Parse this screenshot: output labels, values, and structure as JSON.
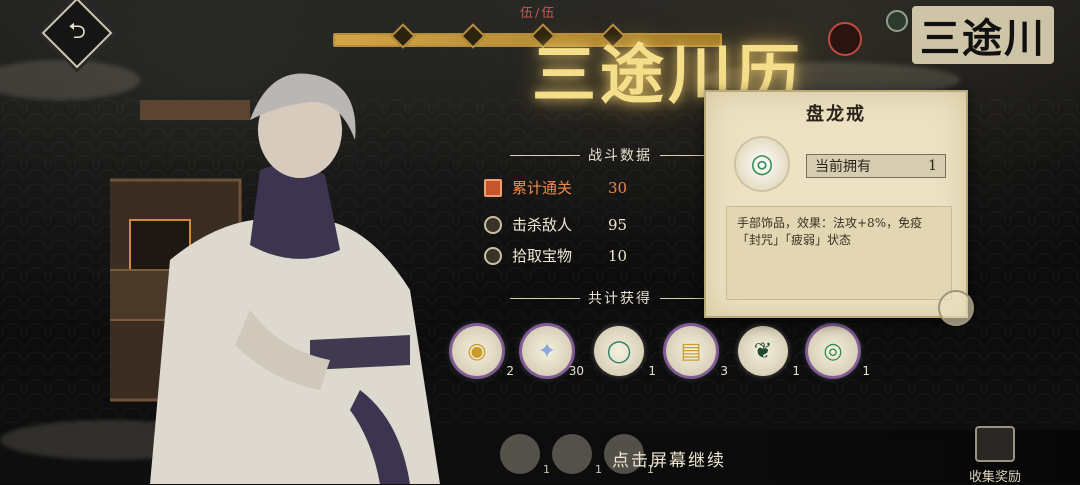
{
  "header": {
    "stage_count": "伍/伍",
    "title": "三途川历",
    "logo": "三途川",
    "progress": 1.0
  },
  "stats": {
    "section_title": "战斗数据",
    "rows": [
      {
        "label": "累计通关",
        "value": "30",
        "icon": "scroll-icon",
        "active": true
      },
      {
        "label": "击杀敌人",
        "value": "95",
        "icon": "coin-icon",
        "active": false
      },
      {
        "label": "拾取宝物",
        "value": "10",
        "icon": "coin-icon",
        "active": false
      }
    ]
  },
  "rewards": {
    "section_title": "共计获得",
    "items": [
      {
        "icon": "gold-coin-icon",
        "count": "2"
      },
      {
        "icon": "crystal-star-icon",
        "count": "30"
      },
      {
        "icon": "bracelet-icon",
        "count": "1"
      },
      {
        "icon": "gold-scroll-icon",
        "count": "3"
      },
      {
        "icon": "dragon-charm-icon",
        "count": "1"
      },
      {
        "icon": "dragon-ring-icon",
        "count": "1"
      }
    ],
    "hidden_items": [
      {
        "count": "1"
      },
      {
        "count": "1"
      },
      {
        "count": "1"
      }
    ]
  },
  "tooltip": {
    "title": "盘龙戒",
    "owned_label": "当前拥有",
    "owned_value": "1",
    "description": "手部饰品，效果：法攻+8%，免疫「封咒」「疲弱」状态"
  },
  "footer": {
    "continue_text": "点击屏幕继续",
    "collect_label": "收集奖励"
  },
  "colors": {
    "accent_gold": "#f4de8a",
    "active_stat": "#f08a4a",
    "parchment": "#ece2c3"
  }
}
